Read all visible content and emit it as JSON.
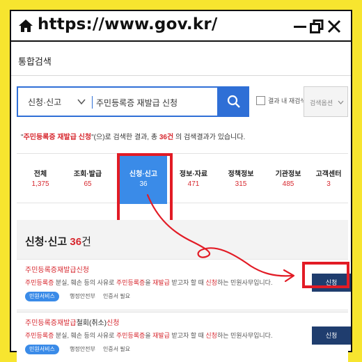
{
  "browser": {
    "url": "https://www.gov.kr/"
  },
  "page": {
    "title": "통합검색"
  },
  "search": {
    "scope": "신청·신고",
    "query": "주민등록증 재발급 신청",
    "search_within_label": "결과 내 재검색",
    "options_label": "검색옵션"
  },
  "result": {
    "prefix": "\"",
    "keyword": "주민등록증 재발급 신청",
    "middle": "\"(으)로 검색한 결과, 총 ",
    "count": "36건",
    "suffix": "의 검색결과가 있습니다."
  },
  "tabs": [
    {
      "label": "전체",
      "count": "1,375"
    },
    {
      "label": "조회·발급",
      "count": "65"
    },
    {
      "label": "신청·신고",
      "count": "36",
      "active": true
    },
    {
      "label": "정보·자료",
      "count": "471"
    },
    {
      "label": "정책정보",
      "count": "315"
    },
    {
      "label": "기관정보",
      "count": "485"
    },
    {
      "label": "고객센터",
      "count": "3"
    }
  ],
  "section": {
    "title": "신청·신고",
    "count": "36",
    "unit": "건"
  },
  "cards": [
    {
      "title_red": "주민등록증재발급신청",
      "title_dark": "",
      "title_red2": "",
      "desc": [
        "주민등록증",
        " 분실, 훼손 등의 사유로 ",
        "주민등록증",
        "을 ",
        "재발급",
        " 받고자 할 때 ",
        "신청",
        "하는 민원사무입니다."
      ],
      "badge": "민원서비스",
      "agency": "행정안전부",
      "cert": "인증서 필요",
      "button": "신청"
    },
    {
      "title_red": "주민등록증재발급",
      "title_dark": "철회(취소)",
      "title_red2": "신청",
      "desc": [
        "주민등록증",
        " 분실, 훼손 등의 사유로 ",
        "주민등록증",
        "을 ",
        "재발급",
        " 받고자 할 때 ",
        "신청",
        "하는 민원사무입니다."
      ],
      "badge": "민원서비스",
      "agency": "행정안전부",
      "cert": "인증서 필요",
      "button": "신청"
    }
  ],
  "colors": {
    "background": "#f7e52f",
    "accent_blue": "#2f6fd6",
    "active_tab": "#3a8be8",
    "highlight_red": "#e21b25",
    "button_navy": "#1f3d6e"
  },
  "icons": [
    "home-icon",
    "minimize-icon",
    "maximize-icon",
    "close-icon",
    "chevron-down-icon",
    "search-icon"
  ]
}
